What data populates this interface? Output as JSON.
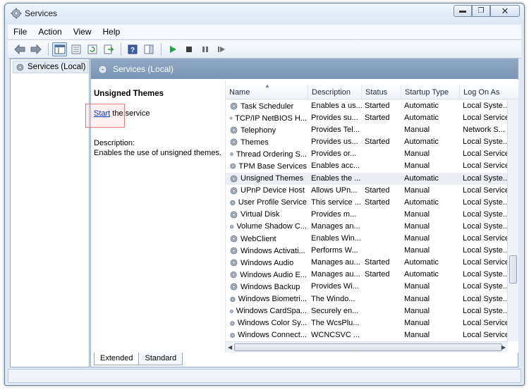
{
  "window": {
    "title": "Services"
  },
  "menu": [
    "File",
    "Action",
    "View",
    "Help"
  ],
  "tree": {
    "item": "Services (Local)"
  },
  "main": {
    "header": "Services (Local)",
    "detail": {
      "title": "Unsigned Themes",
      "start_link": "Start",
      "start_suffix": " the service",
      "desc_label": "Description:",
      "desc_text": "Enables the use of unsigned themes."
    }
  },
  "columns": [
    "Name",
    "Description",
    "Status",
    "Startup Type",
    "Log On As"
  ],
  "services": [
    {
      "name": "Task Scheduler",
      "desc": "Enables a us...",
      "status": "Started",
      "startup": "Automatic",
      "logon": "Local Syste..."
    },
    {
      "name": "TCP/IP NetBIOS H...",
      "desc": "Provides su...",
      "status": "Started",
      "startup": "Automatic",
      "logon": "Local Service"
    },
    {
      "name": "Telephony",
      "desc": "Provides Tel...",
      "status": "",
      "startup": "Manual",
      "logon": "Network S..."
    },
    {
      "name": "Themes",
      "desc": "Provides us...",
      "status": "Started",
      "startup": "Automatic",
      "logon": "Local Syste..."
    },
    {
      "name": "Thread Ordering S...",
      "desc": "Provides or...",
      "status": "",
      "startup": "Manual",
      "logon": "Local Service"
    },
    {
      "name": "TPM Base Services",
      "desc": "Enables acc...",
      "status": "",
      "startup": "Manual",
      "logon": "Local Service"
    },
    {
      "name": "Unsigned Themes",
      "desc": "Enables the ...",
      "status": "",
      "startup": "Automatic",
      "logon": "Local Syste..."
    },
    {
      "name": "UPnP Device Host",
      "desc": "Allows UPn...",
      "status": "Started",
      "startup": "Manual",
      "logon": "Local Service"
    },
    {
      "name": "User Profile Service",
      "desc": "This service ...",
      "status": "Started",
      "startup": "Automatic",
      "logon": "Local Syste..."
    },
    {
      "name": "Virtual Disk",
      "desc": "Provides m...",
      "status": "",
      "startup": "Manual",
      "logon": "Local Syste..."
    },
    {
      "name": "Volume Shadow C...",
      "desc": "Manages an...",
      "status": "",
      "startup": "Manual",
      "logon": "Local Syste..."
    },
    {
      "name": "WebClient",
      "desc": "Enables Win...",
      "status": "",
      "startup": "Manual",
      "logon": "Local Service"
    },
    {
      "name": "Windows Activati...",
      "desc": "Performs W...",
      "status": "",
      "startup": "Manual",
      "logon": "Local Syste..."
    },
    {
      "name": "Windows Audio",
      "desc": "Manages au...",
      "status": "Started",
      "startup": "Automatic",
      "logon": "Local Service"
    },
    {
      "name": "Windows Audio E...",
      "desc": "Manages au...",
      "status": "Started",
      "startup": "Automatic",
      "logon": "Local Syste..."
    },
    {
      "name": "Windows Backup",
      "desc": "Provides Wi...",
      "status": "",
      "startup": "Manual",
      "logon": "Local Syste..."
    },
    {
      "name": "Windows Biometri...",
      "desc": "The Windo...",
      "status": "",
      "startup": "Manual",
      "logon": "Local Syste..."
    },
    {
      "name": "Windows CardSpa...",
      "desc": "Securely en...",
      "status": "",
      "startup": "Manual",
      "logon": "Local Syste..."
    },
    {
      "name": "Windows Color Sy...",
      "desc": "The WcsPlu...",
      "status": "",
      "startup": "Manual",
      "logon": "Local Service"
    },
    {
      "name": "Windows Connect...",
      "desc": "WCNCSVC ...",
      "status": "",
      "startup": "Manual",
      "logon": "Local Service"
    }
  ],
  "tabs": [
    "Extended",
    "Standard"
  ],
  "colors": {
    "header": "#7a95b5",
    "link": "#0033cc",
    "play": "#1fa83a"
  }
}
